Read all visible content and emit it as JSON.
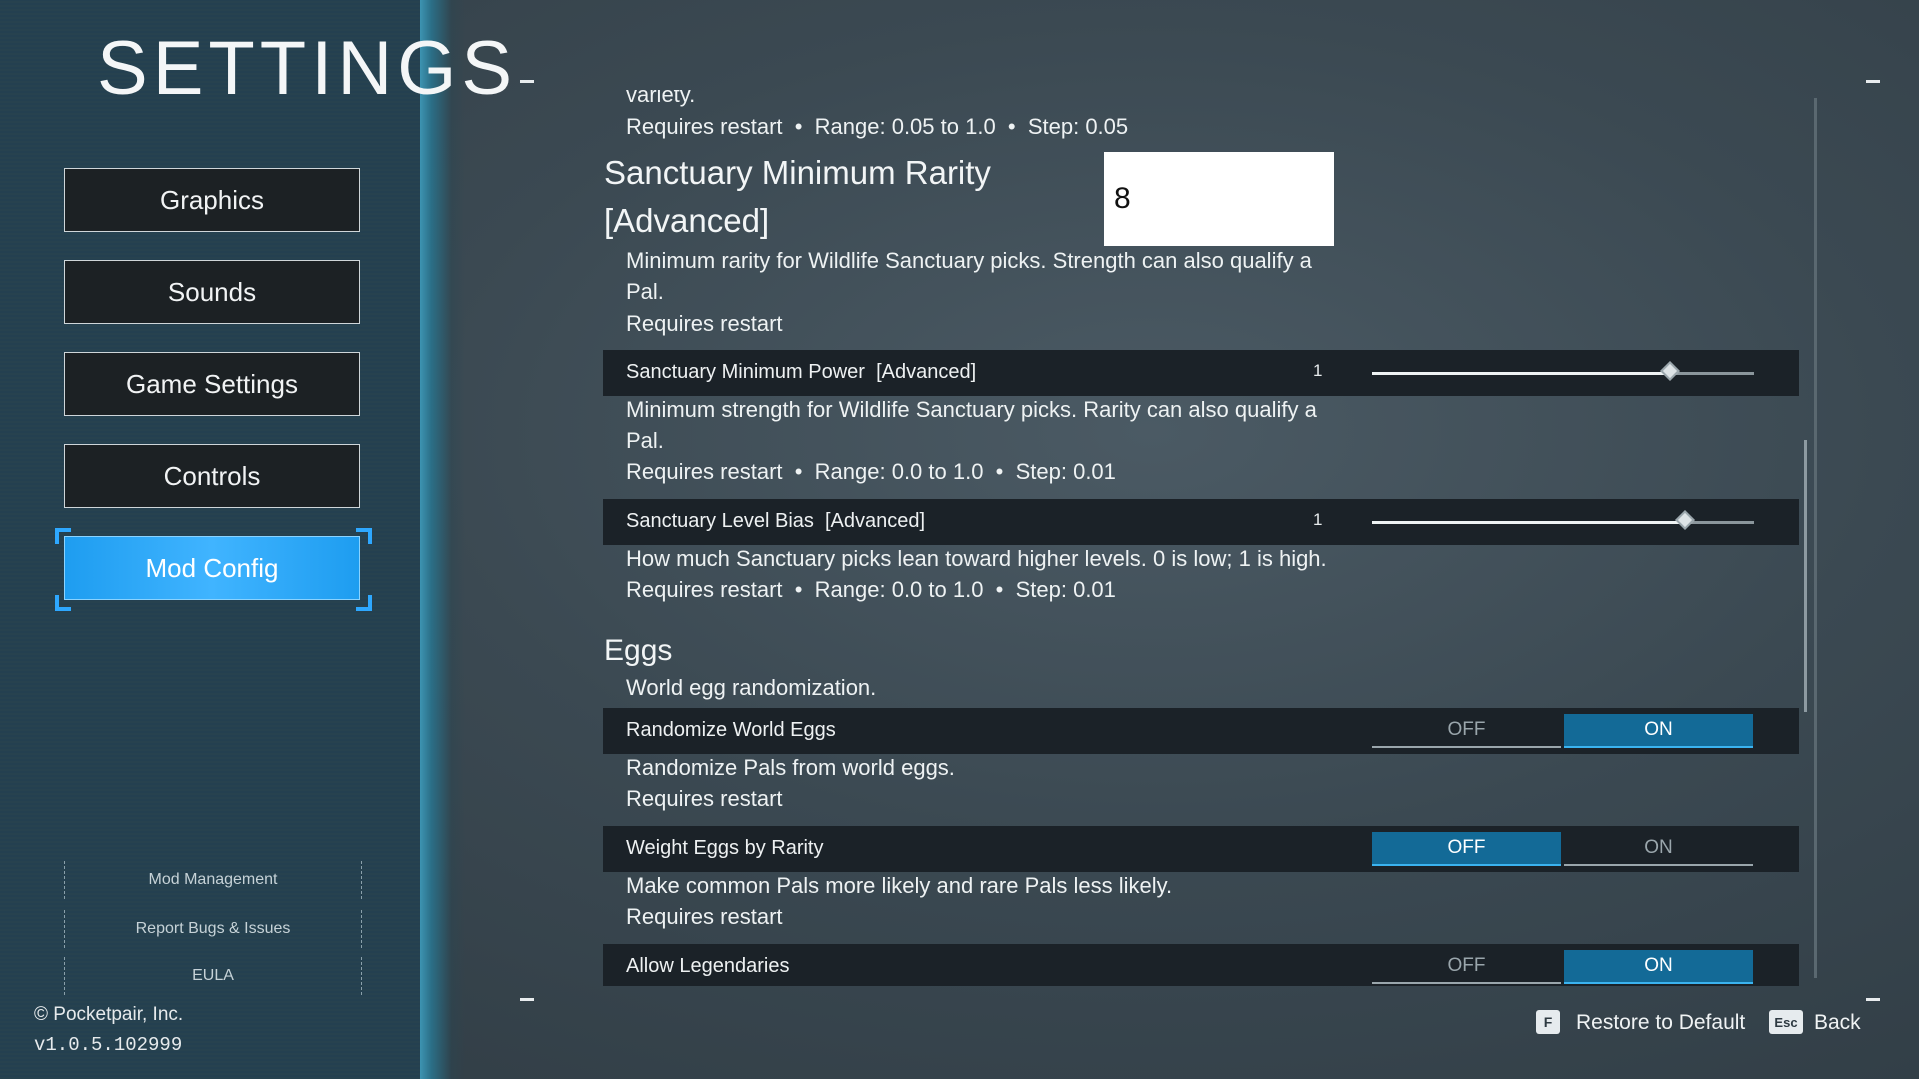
{
  "sidebar": {
    "title": "SETTINGS",
    "nav": [
      {
        "label": "Graphics"
      },
      {
        "label": "Sounds"
      },
      {
        "label": "Game Settings"
      },
      {
        "label": "Controls"
      },
      {
        "label": "Mod Config",
        "active": true
      }
    ],
    "links": [
      {
        "label": "Mod Management"
      },
      {
        "label": "Report Bugs & Issues"
      },
      {
        "label": "EULA"
      }
    ],
    "copyright": "© Pocketpair, Inc.",
    "version": "v1.0.5.102999"
  },
  "main": {
    "cut_text": "variety.",
    "top_meta": "Requires restart  •  Range: 0.05 to 1.0  •  Step: 0.05",
    "rarity": {
      "title_line1": "Sanctuary Minimum Rarity",
      "title_line2": "[Advanced]",
      "value": "8",
      "desc_line1": "Minimum rarity for Wildlife Sanctuary picks. Strength can also qualify a",
      "desc_line2": "Pal.",
      "meta": "Requires restart"
    },
    "power": {
      "label": "Sanctuary Minimum Power  [Advanced]",
      "value": "1",
      "level": 0.78,
      "desc_line1": "Minimum strength for Wildlife Sanctuary picks. Rarity can also qualify a",
      "desc_line2": "Pal.",
      "meta": "Requires restart  •  Range: 0.0 to 1.0  •  Step: 0.01"
    },
    "level_bias": {
      "label": "Sanctuary Level Bias  [Advanced]",
      "value": "1",
      "level": 0.82,
      "desc": "How much Sanctuary picks lean toward higher levels. 0 is low; 1 is high.",
      "meta": "Requires restart  •  Range: 0.0 to 1.0  •  Step: 0.01"
    },
    "eggs": {
      "header": "Eggs",
      "subtitle": "World egg randomization."
    },
    "randomize_eggs": {
      "label": "Randomize World Eggs",
      "off_label": "OFF",
      "on_label": "ON",
      "state": "on",
      "desc": "Randomize Pals from world eggs.",
      "meta": "Requires restart"
    },
    "weight_eggs": {
      "label": "Weight Eggs by Rarity",
      "off_label": "OFF",
      "on_label": "ON",
      "state": "off",
      "desc": "Make common Pals more likely and rare Pals less likely.",
      "meta": "Requires restart"
    },
    "legendaries": {
      "label": "Allow Legendaries",
      "off_label": "OFF",
      "on_label": "ON",
      "state": "on"
    }
  },
  "footer": {
    "restore_key": "F",
    "restore_label": "Restore to Default",
    "back_key": "Esc",
    "back_label": "Back"
  },
  "colors": {
    "accent": "#1e9df0",
    "toggle_on": "#136a97",
    "sidebar_bg": "#27424f"
  }
}
